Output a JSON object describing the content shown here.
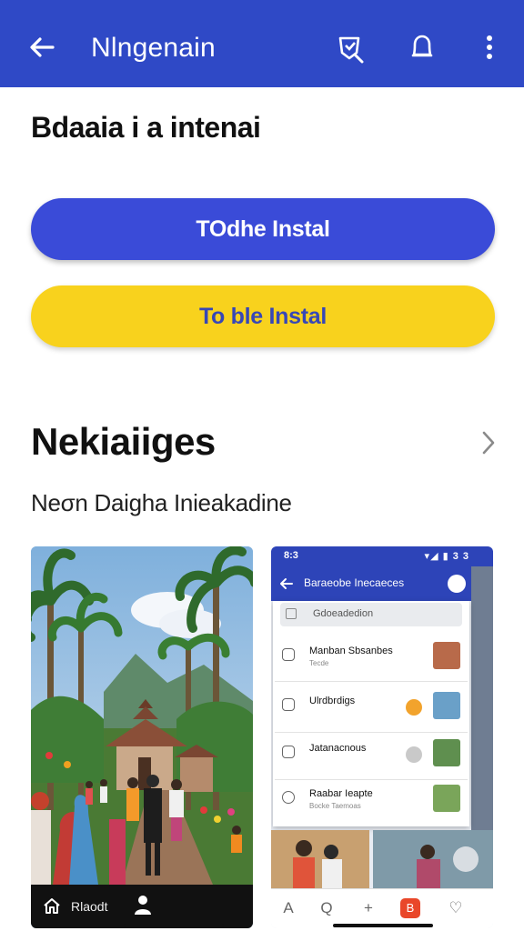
{
  "app_bar": {
    "title": "Nlngenain",
    "back_icon": "arrow-left-icon",
    "actions": [
      "shield-edit-icon",
      "bell-icon",
      "more-vert-icon"
    ],
    "color": "#2f49c6"
  },
  "heading": "Bdaaia i a intenai",
  "buttons": {
    "primary_label": "TOdhe Instal",
    "secondary_label": "To ble Instal",
    "primary_color": "#3a4bd8",
    "secondary_color": "#f8d21d"
  },
  "section": {
    "title": "Nekiaiiges",
    "subtitle": "Neσn Daigha Inieakadine",
    "chevron_icon": "chevron-right-icon"
  },
  "screenshot_1": {
    "nav_label": "Rlaodt",
    "nav_icons": [
      "home-icon",
      "person-icon"
    ]
  },
  "screenshot_2": {
    "status_time": "8:3",
    "status_icons": "▾◢ ▮ 3 3",
    "bar_title": "Baraeobe Inecaeces",
    "search_placeholder": "Gdoeadedion",
    "rows": [
      {
        "title": "Manban Sbsanbes",
        "subtitle": "Tecde"
      },
      {
        "title": "Ulrdbrdigs",
        "subtitle": ""
      },
      {
        "title": "Jatanacnous",
        "subtitle": ""
      },
      {
        "title": "Raabar Ieapte",
        "subtitle": "Bocke Taemoas"
      }
    ],
    "tab_icons": [
      "A",
      "Q",
      "+",
      "B",
      "♡"
    ]
  }
}
